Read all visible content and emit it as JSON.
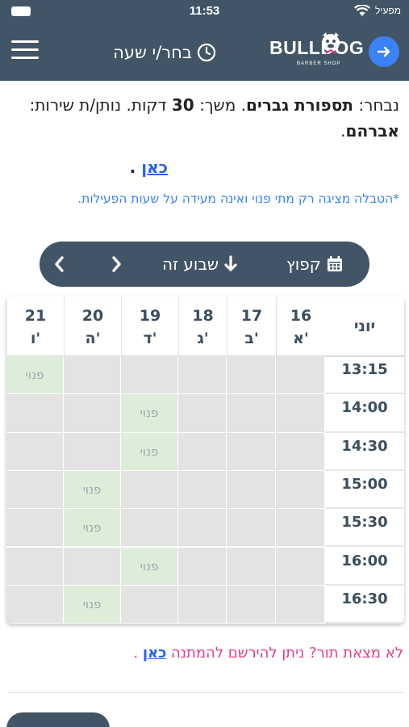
{
  "status": {
    "time": "11:53",
    "carrier": "מפעיל"
  },
  "header": {
    "title": "בחר/י שעה",
    "logo_text": "BULLDOG",
    "logo_sub": "BARBER SHOP"
  },
  "info": {
    "prefix": "נבחר: ",
    "service": "תספורת גברים",
    "duration_label": ". משך: ",
    "duration": "30",
    "duration_unit": " דקות. נותן/ת שירות: ",
    "provider": "אברהם",
    "end": ".",
    "here_link": "כאן",
    "here_dot": "."
  },
  "note": "*הטבלה מציגה רק מתי פנוי ואינה מעידה על שעות הפעילות.",
  "week_nav": {
    "jump": "קפוץ",
    "this_week": "שבוע זה"
  },
  "schedule": {
    "month": "יוני",
    "days": [
      {
        "date": "16",
        "day": "א'"
      },
      {
        "date": "17",
        "day": "ב'"
      },
      {
        "date": "18",
        "day": "ג'"
      },
      {
        "date": "19",
        "day": "ד'"
      },
      {
        "date": "20",
        "day": "ה'"
      },
      {
        "date": "21",
        "day": "ו'"
      }
    ],
    "times": [
      "13:15",
      "14:00",
      "14:30",
      "15:00",
      "15:30",
      "16:00",
      "16:30"
    ],
    "free_label": "פנוי",
    "availability": [
      [
        false,
        false,
        false,
        false,
        false,
        true
      ],
      [
        false,
        false,
        false,
        true,
        false,
        false
      ],
      [
        false,
        false,
        false,
        true,
        false,
        false
      ],
      [
        false,
        false,
        false,
        false,
        true,
        false
      ],
      [
        false,
        false,
        false,
        false,
        true,
        false
      ],
      [
        false,
        false,
        false,
        true,
        false,
        false
      ],
      [
        false,
        false,
        false,
        false,
        true,
        false
      ]
    ]
  },
  "waitlist": {
    "text": "לא מצאת תור? ניתן להירשם להמתנה ",
    "link": "כאן",
    "end": " ."
  },
  "colors": {
    "header_bg": "#415566",
    "free_slot": "#ddedd9",
    "empty_slot": "#e3e3e3",
    "link": "#2563eb",
    "waitlist_text": "#e93a8e",
    "note_text": "#3b82f6"
  }
}
